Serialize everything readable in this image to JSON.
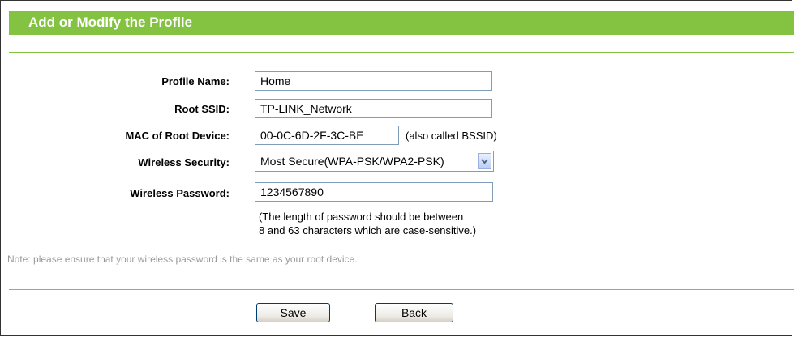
{
  "header": {
    "title": "Add or Modify the Profile"
  },
  "form": {
    "profile_name": {
      "label": "Profile Name:",
      "value": "Home"
    },
    "root_ssid": {
      "label": "Root SSID:",
      "value": "TP-LINK_Network"
    },
    "mac_root": {
      "label": "MAC of Root Device:",
      "value": "00-0C-6D-2F-3C-BE",
      "hint": "(also called BSSID)"
    },
    "security": {
      "label": "Wireless Security:",
      "selected": "Most Secure(WPA-PSK/WPA2-PSK)"
    },
    "password": {
      "label": "Wireless Password:",
      "value": "1234567890",
      "hint_line1": "(The length of password should be between",
      "hint_line2": "8 and 63 characters which are case-sensitive.)"
    }
  },
  "note": "Note: please ensure that your wireless password is the same as your root device.",
  "buttons": {
    "save": "Save",
    "back": "Back"
  },
  "colors": {
    "header_bg": "#84c341",
    "note_text": "#999999"
  },
  "icons": {
    "dropdown": "chevron-down-icon"
  }
}
